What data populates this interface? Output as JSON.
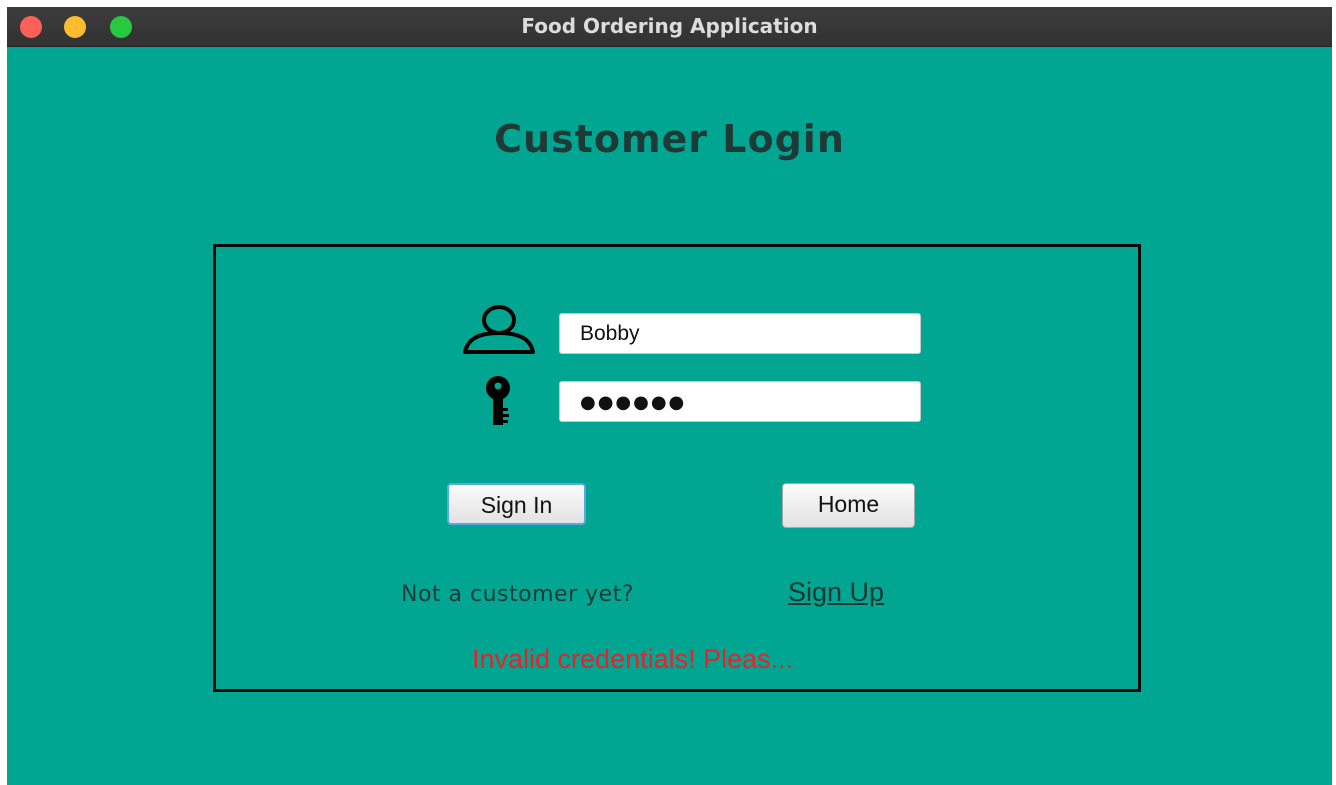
{
  "window": {
    "title": "Food Ordering Application",
    "background_color": "#00a692"
  },
  "heading": "Customer Login",
  "login_form": {
    "username_value": "Bobby",
    "password_masked": "●●●●●●",
    "username_icon": "user-icon",
    "password_icon": "key-icon"
  },
  "buttons": {
    "sign_in_label": "Sign In",
    "home_label": "Home"
  },
  "signup": {
    "prompt": "Not a customer yet?",
    "link_label": "Sign Up"
  },
  "status": {
    "error_message": "Invalid credentials! Pleas...",
    "error_color": "#e8222a"
  }
}
